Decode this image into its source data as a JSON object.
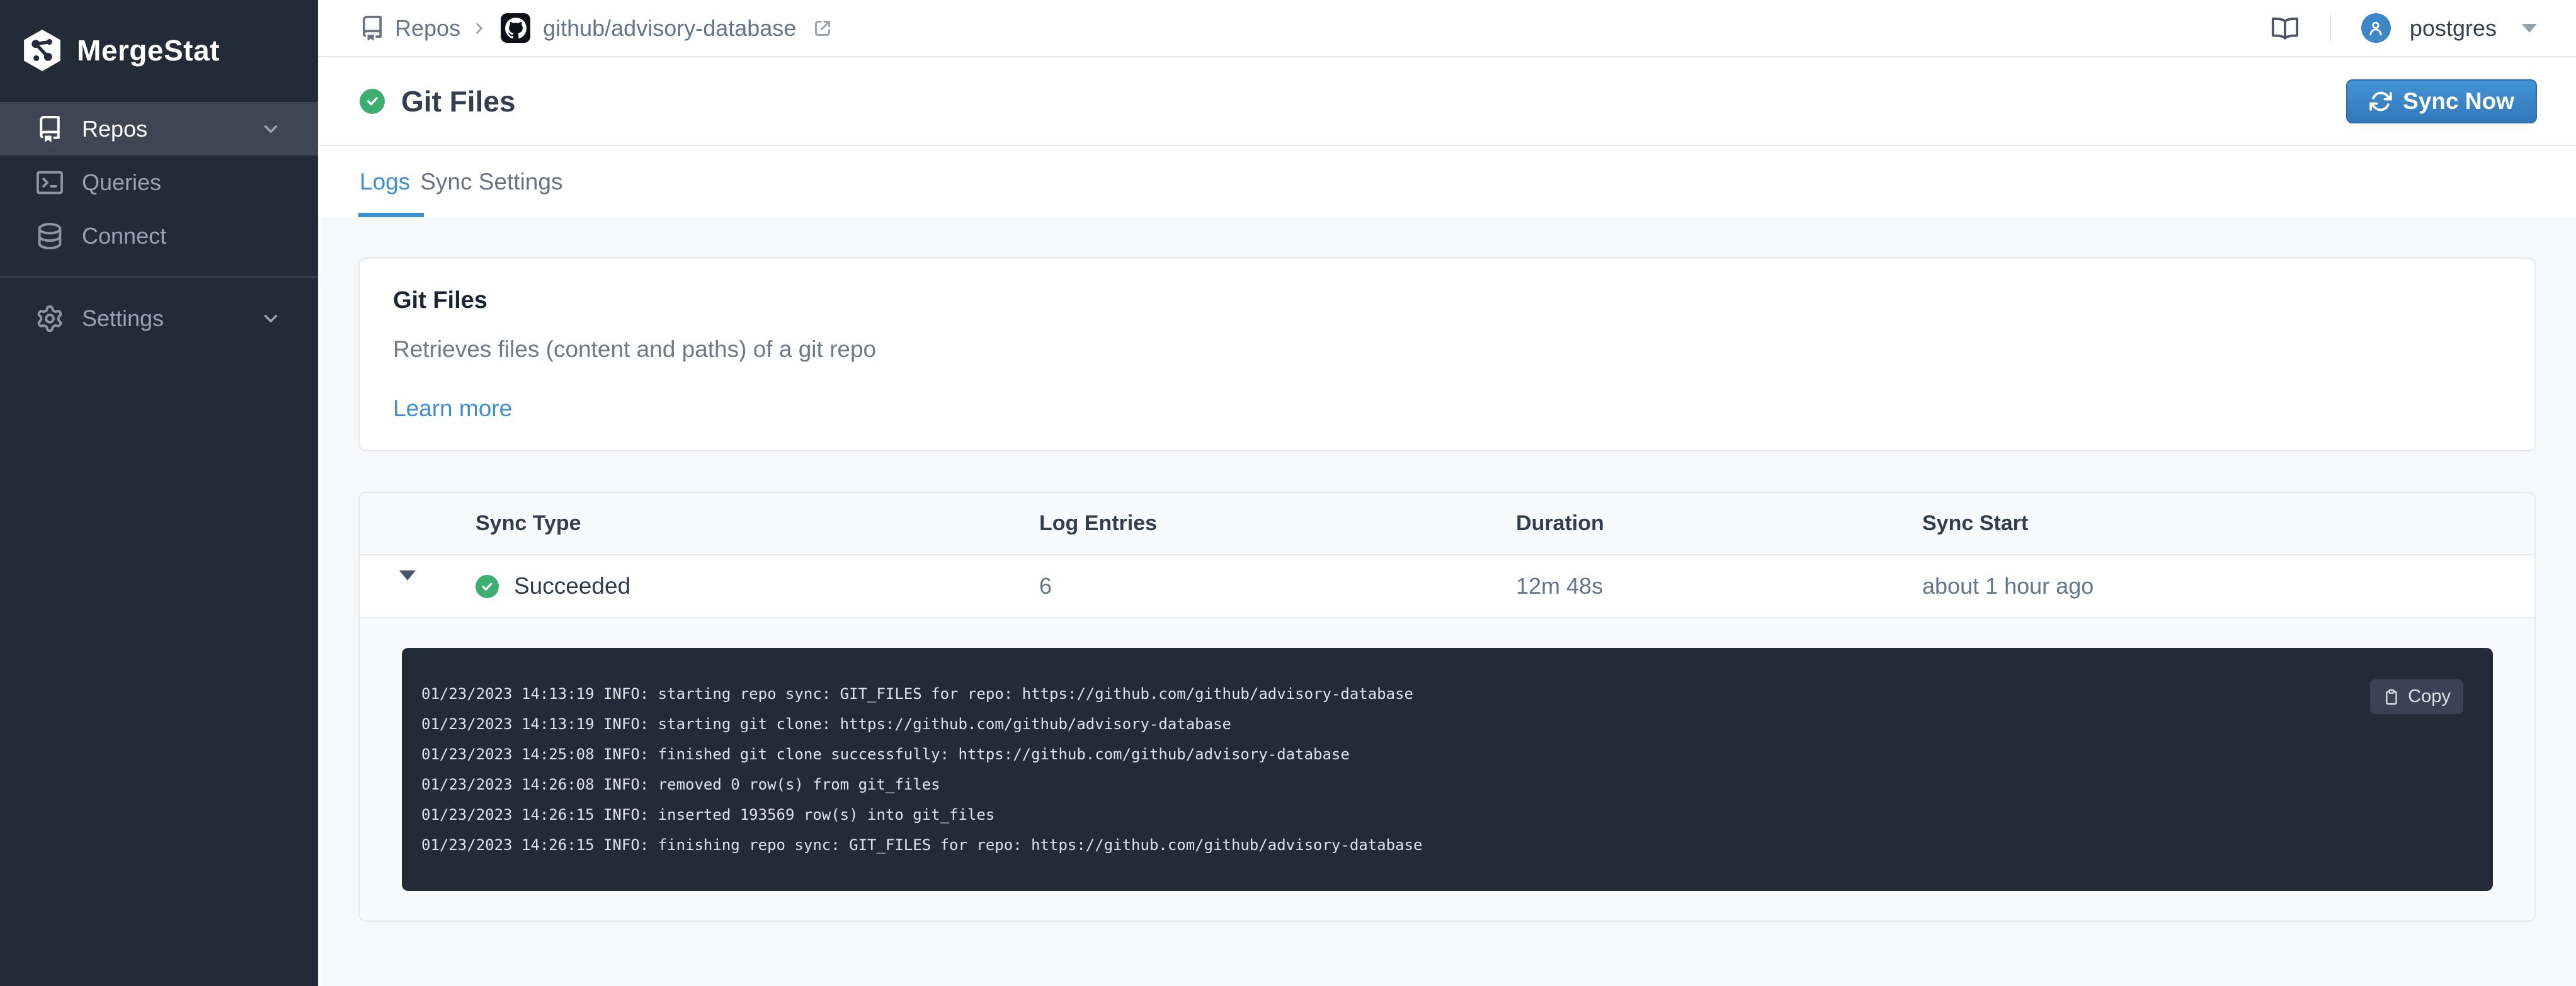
{
  "sidebar": {
    "logo": "MergeStat",
    "items": [
      {
        "label": "Repos"
      },
      {
        "label": "Queries"
      },
      {
        "label": "Connect"
      },
      {
        "label": "Settings"
      }
    ]
  },
  "topbar": {
    "breadcrumb": {
      "root": "Repos",
      "repo": "github/advisory-database"
    },
    "user": "postgres"
  },
  "page": {
    "title": "Git Files",
    "sync_button": "Sync Now"
  },
  "tabs": [
    {
      "label": "Logs"
    },
    {
      "label": "Sync Settings"
    }
  ],
  "sync_card": {
    "title": "Git Files",
    "description": "Retrieves files (content and paths) of a git repo",
    "link": "Learn more"
  },
  "table": {
    "headers": [
      "Sync Type",
      "Log Entries",
      "Duration",
      "Sync Start"
    ],
    "row": {
      "status": "Succeeded",
      "log_entries": "6",
      "duration": "12m 48s",
      "sync_start": "about 1 hour ago"
    }
  },
  "log_panel": {
    "copy_button": "Copy",
    "lines": [
      "01/23/2023 14:13:19 INFO: starting repo sync: GIT_FILES for repo: https://github.com/github/advisory-database",
      "01/23/2023 14:13:19 INFO: starting git clone: https://github.com/github/advisory-database",
      "01/23/2023 14:25:08 INFO: finished git clone successfully: https://github.com/github/advisory-database",
      "01/23/2023 14:26:08 INFO: removed 0 row(s) from git_files",
      "01/23/2023 14:26:15 INFO: inserted 193569 row(s) into git_files",
      "01/23/2023 14:26:15 INFO: finishing repo sync: GIT_FILES for repo: https://github.com/github/advisory-database"
    ]
  },
  "colors": {
    "accent_blue": "#3e8ed4",
    "success_green": "#3eae73",
    "sidebar_bg": "#232b39"
  }
}
